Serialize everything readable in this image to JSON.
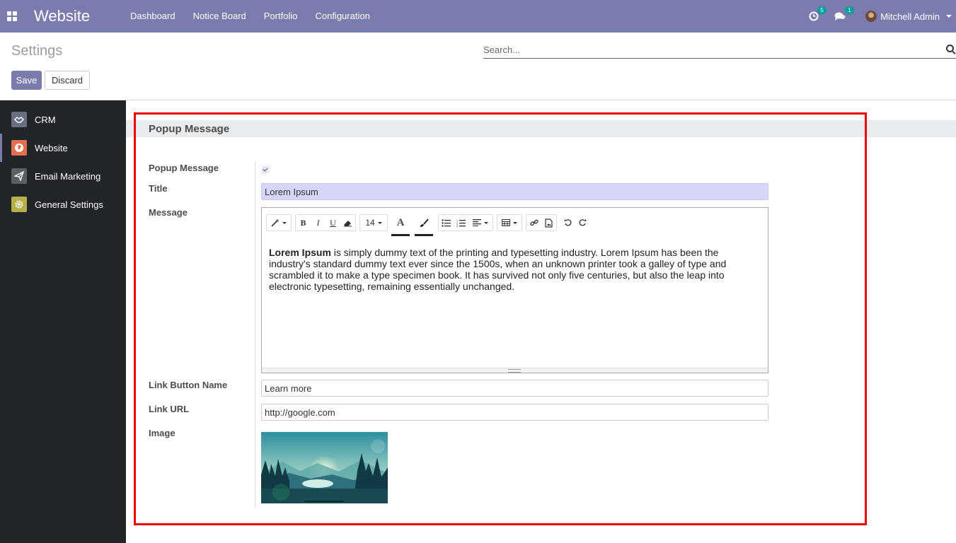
{
  "app": {
    "title": "Website",
    "menu": [
      "Dashboard",
      "Notice Board",
      "Portfolio",
      "Configuration"
    ],
    "activity_count": "5",
    "message_count": "1",
    "user_name": "Mitchell Admin"
  },
  "control_panel": {
    "title": "Settings",
    "search_placeholder": "Search...",
    "save_label": "Save",
    "discard_label": "Discard"
  },
  "sidebar": {
    "items": [
      {
        "label": "CRM",
        "color": "#6b6f82"
      },
      {
        "label": "Website",
        "color": "#e46f4e"
      },
      {
        "label": "Email Marketing",
        "color": "#5c5f66"
      },
      {
        "label": "General Settings",
        "color": "#b5b049"
      }
    ],
    "active_index": 1
  },
  "section": {
    "title": "Popup Message",
    "popup_label": "Popup Message",
    "popup_checked": true,
    "title_label": "Title",
    "title_value": "Lorem Ipsum",
    "message_label": "Message",
    "font_size": "14",
    "message_bold": "Lorem Ipsum",
    "message_rest": " is simply dummy text of the printing and typesetting industry. Lorem Ipsum has been the industry's standard dummy text ever since the 1500s, when an unknown printer took a galley of type and scrambled it to make a type specimen book. It has survived not only five centuries, but also the leap into electronic typesetting, remaining essentially unchanged.",
    "link_button_label": "Link Button Name",
    "link_button_value": "Learn more",
    "link_url_label": "Link URL",
    "link_url_value": "http://google.com",
    "image_label": "Image"
  },
  "colors": {
    "navbar": "#7c7bad",
    "sidebar_bg": "#212529",
    "highlight_box": "#e00000"
  }
}
